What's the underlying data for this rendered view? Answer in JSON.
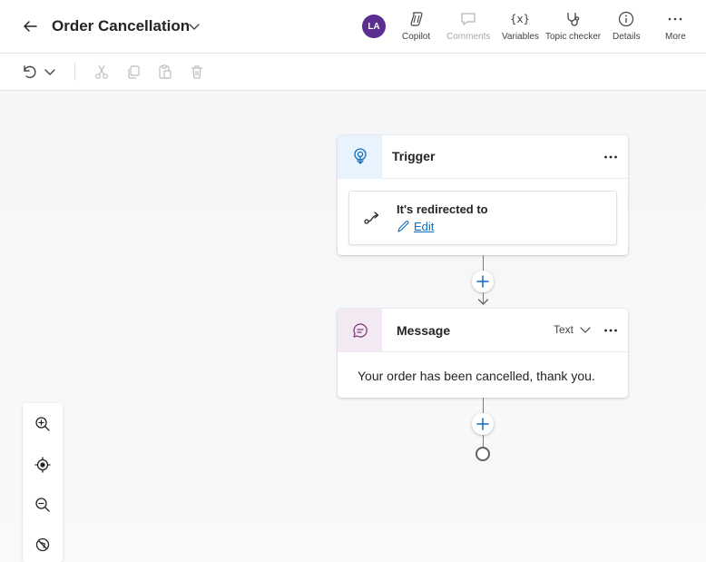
{
  "header": {
    "title": "Order Cancellation",
    "avatar_initials": "LA",
    "avatar_color": "#5c2e91",
    "tools": [
      {
        "label": "Copilot",
        "icon": "copilot-icon"
      },
      {
        "label": "Comments",
        "icon": "comment-icon",
        "disabled": true
      },
      {
        "label": "Variables",
        "icon": "variables-icon"
      },
      {
        "label": "Topic checker",
        "icon": "stethoscope-icon"
      },
      {
        "label": "Details",
        "icon": "info-icon"
      },
      {
        "label": "More",
        "icon": "more-icon"
      }
    ]
  },
  "toolbar": {
    "items": [
      "undo-icon",
      "chevron-down-icon",
      "cut-icon",
      "copy-icon",
      "paste-icon",
      "delete-icon"
    ]
  },
  "trigger_node": {
    "title": "Trigger",
    "redirect_label": "It's redirected to",
    "edit_label": "Edit",
    "icon_bg": "#e8f3fd",
    "accent": "#0f6cbd"
  },
  "message_node": {
    "title": "Message",
    "type_select": "Text",
    "body": "Your order has been cancelled, thank you.",
    "icon_bg": "#f2e9f2",
    "accent": "#7a3b7a"
  },
  "zoom_controls": [
    "zoom-in-icon",
    "recenter-icon",
    "zoom-out-icon",
    "minimap-off-icon"
  ]
}
